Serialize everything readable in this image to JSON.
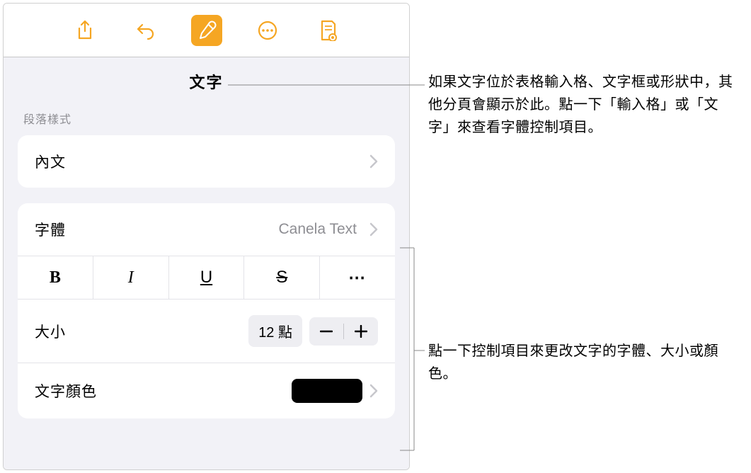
{
  "toolbar": {
    "icons": [
      "share-icon",
      "undo-icon",
      "format-paint-icon",
      "more-icon",
      "document-view-icon"
    ]
  },
  "tab": {
    "label": "文字"
  },
  "paragraph_section": {
    "caption": "段落樣式",
    "style_name": "內文"
  },
  "font_section": {
    "font_label": "字體",
    "font_value": "Canela Text",
    "style_buttons": {
      "bold": "B",
      "italic": "I",
      "underline": "U",
      "strike": "S",
      "more": "⋯"
    },
    "size_label": "大小",
    "size_value": "12 點",
    "color_label": "文字顏色",
    "color_value": "#000000"
  },
  "callouts": {
    "c1": "如果文字位於表格輸入格、文字框或形狀中，其他分頁會顯示於此。點一下「輸入格」或「文字」來查看字體控制項目。",
    "c2": "點一下控制項目來更改文字的字體、大小或顏色。"
  }
}
